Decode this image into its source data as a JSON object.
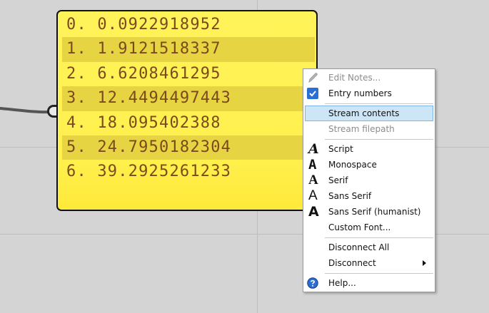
{
  "panel": {
    "rows": [
      {
        "text": "0. 0.0922918952"
      },
      {
        "text": "1. 1.9121518337"
      },
      {
        "text": "2. 6.6208461295"
      },
      {
        "text": "3. 12.4494497443"
      },
      {
        "text": "4. 18.095402388"
      },
      {
        "text": "5. 24.7950182304"
      },
      {
        "text": "6. 39.2925261233"
      }
    ]
  },
  "menu": {
    "edit_notes": "Edit Notes...",
    "entry_numbers": "Entry numbers",
    "stream_contents": "Stream contents",
    "stream_filepath": "Stream filepath",
    "script": "Script",
    "monospace": "Monospace",
    "serif": "Serif",
    "sans_serif": "Sans Serif",
    "sans_serif_humanist": "Sans Serif (humanist)",
    "custom_font": "Custom Font...",
    "disconnect_all": "Disconnect All",
    "disconnect": "Disconnect",
    "help": "Help...",
    "font_icon_glyph": "A"
  },
  "colors": {
    "panel_fill": "#fff04d",
    "panel_stripe": "#e6d442",
    "panel_text": "#7a4a1e",
    "menu_highlight": "#cde6f7",
    "check_blue": "#2a6fd6",
    "help_blue": "#2a6fd6"
  },
  "icons": {
    "edit_notes": "pencil-icon",
    "entry_numbers": "check-icon",
    "fonts": "font-a-icon",
    "disconnect": "submenu-arrow-icon",
    "help": "help-icon"
  }
}
